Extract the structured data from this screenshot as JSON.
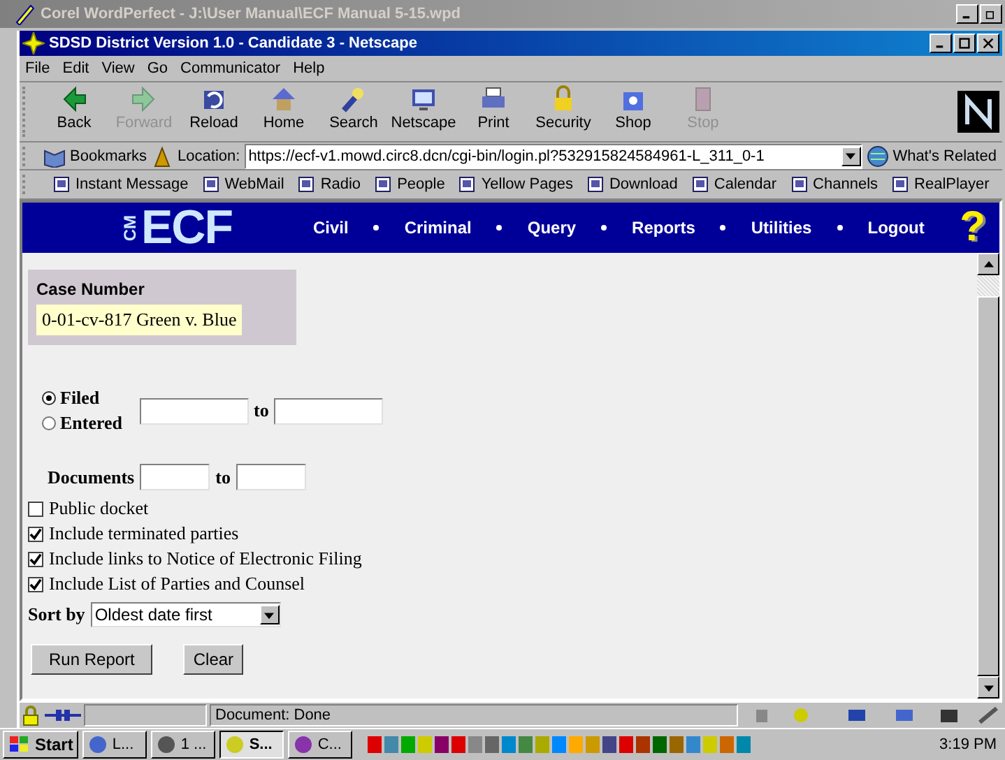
{
  "outer_window": {
    "title": "Corel WordPerfect - J:\\User Manual\\ECF Manual 5-15.wpd"
  },
  "window": {
    "title": "SDSD District Version 1.0 - Candidate 3 - Netscape"
  },
  "menu": [
    "File",
    "Edit",
    "View",
    "Go",
    "Communicator",
    "Help"
  ],
  "toolbar": [
    {
      "label": "Back",
      "disabled": false
    },
    {
      "label": "Forward",
      "disabled": true
    },
    {
      "label": "Reload",
      "disabled": false
    },
    {
      "label": "Home",
      "disabled": false
    },
    {
      "label": "Search",
      "disabled": false
    },
    {
      "label": "Netscape",
      "disabled": false
    },
    {
      "label": "Print",
      "disabled": false
    },
    {
      "label": "Security",
      "disabled": false
    },
    {
      "label": "Shop",
      "disabled": false
    },
    {
      "label": "Stop",
      "disabled": true
    }
  ],
  "location_bar": {
    "bookmarks": "Bookmarks",
    "label": "Location:",
    "url": "https://ecf-v1.mowd.circ8.dcn/cgi-bin/login.pl?532915824584961-L_311_0-1",
    "related": "What's Related"
  },
  "personal_toolbar": [
    "Instant Message",
    "WebMail",
    "Radio",
    "People",
    "Yellow Pages",
    "Download",
    "Calendar",
    "Channels",
    "RealPlayer"
  ],
  "banner": {
    "logo_small": "CM",
    "logo": "ECF",
    "nav": [
      "Civil",
      "Criminal",
      "Query",
      "Reports",
      "Utilities",
      "Logout"
    ],
    "help_icon": "?"
  },
  "case": {
    "label": "Case Number",
    "value": "0-01-cv-817 Green v. Blue"
  },
  "date_type": [
    {
      "label": "Filed",
      "selected": true
    },
    {
      "label": "Entered",
      "selected": false
    }
  ],
  "date_to": "to",
  "documents": {
    "label": "Documents",
    "to": "to"
  },
  "options": [
    {
      "label": "Public docket",
      "checked": false
    },
    {
      "label": "Include terminated parties",
      "checked": true
    },
    {
      "label": "Include links to Notice of Electronic Filing",
      "checked": true
    },
    {
      "label": "Include List of Parties and Counsel",
      "checked": true
    }
  ],
  "sort": {
    "label": "Sort by",
    "value": "Oldest date first"
  },
  "buttons": [
    "Run Report",
    "Clear"
  ],
  "status_bar": {
    "text": "Document: Done"
  },
  "taskbar": {
    "start": "Start",
    "tasks": [
      {
        "label": "L...",
        "selected": false
      },
      {
        "label": "1 ...",
        "selected": false
      },
      {
        "label": "S...",
        "selected": true
      },
      {
        "label": "C...",
        "selected": false
      }
    ],
    "clock": "3:19 PM"
  }
}
